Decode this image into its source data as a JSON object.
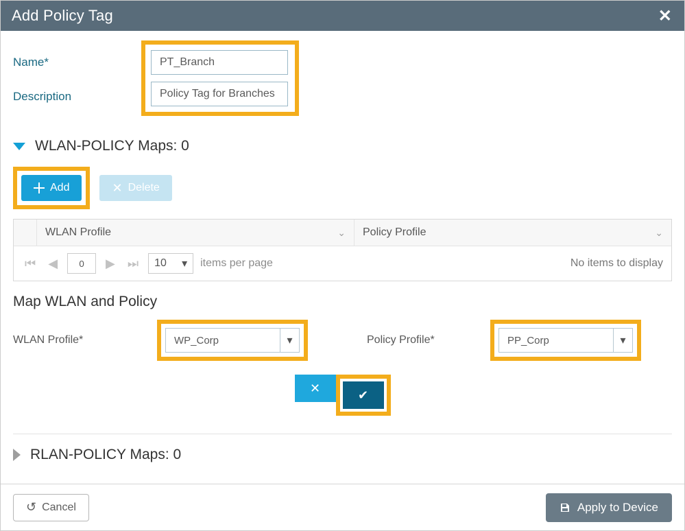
{
  "dialog": {
    "title": "Add Policy Tag"
  },
  "form": {
    "name_label": "Name*",
    "name_value": "PT_Branch",
    "desc_label": "Description",
    "desc_value": "Policy Tag for Branches"
  },
  "wlan_policy_section": {
    "title": "WLAN-POLICY Maps: 0",
    "add_label": "Add",
    "delete_label": "Delete",
    "col_wlan": "WLAN Profile",
    "col_policy": "Policy Profile",
    "page_num": "0",
    "per_page": "10",
    "per_page_suffix": "items per page",
    "empty_text": "No items to display"
  },
  "map_section": {
    "title": "Map WLAN and Policy",
    "wlan_label": "WLAN Profile*",
    "wlan_value": "WP_Corp",
    "policy_label": "Policy Profile*",
    "policy_value": "PP_Corp"
  },
  "rlan_section": {
    "title": "RLAN-POLICY Maps: 0"
  },
  "footer": {
    "cancel": "Cancel",
    "apply": "Apply to Device"
  }
}
